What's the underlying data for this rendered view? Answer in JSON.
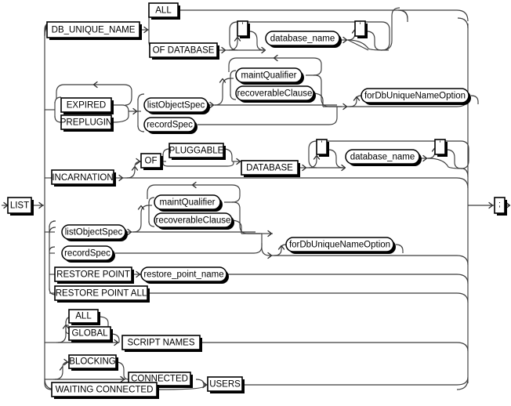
{
  "diagram": {
    "type": "railroad-syntax-diagram",
    "title": "LIST",
    "start_terminal": "LIST",
    "end_terminal": ";",
    "stroke_color": "#000000",
    "background_color": "#ffffff"
  },
  "nodes": {
    "list": "LIST",
    "db_unique_name": "DB_UNIQUE_NAME",
    "all_1": "ALL",
    "of_database": "OF DATABASE",
    "quote_open_1": "'",
    "database_name_1": "database_name",
    "quote_close_1": "'",
    "expired": "EXPIRED",
    "preplugin": "PREPLUGIN",
    "list_object_spec_1": "listObjectSpec",
    "record_spec_1": "recordSpec",
    "maint_qualifier_1": "maintQualifier",
    "recoverable_clause_1": "recoverableClause",
    "for_db_unique_name_option_1": "forDbUniqueNameOption",
    "incarnation": "INCARNATION",
    "of": "OF",
    "pluggable": "PLUGGABLE",
    "database": "DATABASE",
    "quote_open_2": "'",
    "database_name_2": "database_name",
    "quote_close_2": "'",
    "maint_qualifier_2": "maintQualifier",
    "recoverable_clause_2": "recoverableClause",
    "list_object_spec_2": "listObjectSpec",
    "record_spec_2": "recordSpec",
    "restore_point": "RESTORE POINT",
    "restore_point_name": "restore_point_name",
    "restore_point_all": "RESTORE POINT ALL",
    "for_db_unique_name_option_2": "forDbUniqueNameOption",
    "all_2": "ALL",
    "global": "GLOBAL",
    "script_names": "SCRIPT NAMES",
    "blocking": "BLOCKING",
    "connected": "CONNECTED",
    "waiting_connected": "WAITING CONNECTED",
    "users": "USERS",
    "semicolon": ";"
  }
}
